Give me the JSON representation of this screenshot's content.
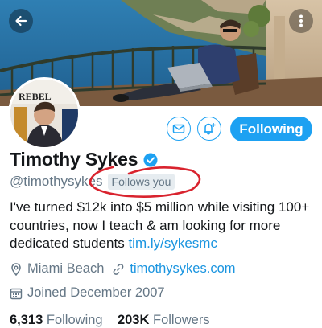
{
  "colors": {
    "accent": "#1da1f2",
    "link": "#1b95e0",
    "muted": "#657786",
    "text": "#14171a",
    "annotation": "#d9232e"
  },
  "header": {
    "back_icon": "arrow-left-icon",
    "more_icon": "more-vertical-icon"
  },
  "avatar": {
    "magazine_word": "REBEL"
  },
  "actions": {
    "message_icon": "envelope-icon",
    "notify_icon": "bell-plus-icon",
    "follow_label": "Following"
  },
  "profile": {
    "name": "Timothy Sykes",
    "handle": "@timothysykes",
    "follows_you": "Follows you",
    "bio_text": "I've turned $12k into $5 million while visiting 100+ countries, now I teach & am looking for more dedicated students ",
    "bio_link": "tim.ly/sykesmc",
    "location": "Miami Beach",
    "website": "timothysykes.com",
    "joined": "Joined December 2007"
  },
  "stats": {
    "following_count": "6,313",
    "following_label": "Following",
    "followers_count": "203K",
    "followers_label": "Followers"
  }
}
